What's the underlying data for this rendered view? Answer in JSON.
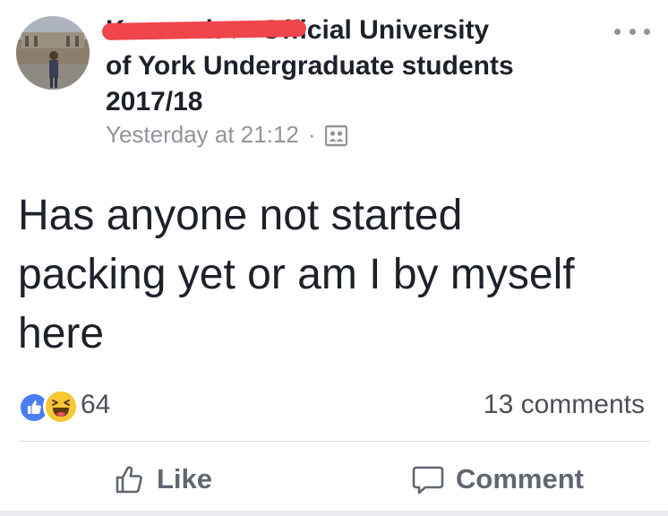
{
  "post": {
    "author_redacted": "K———h",
    "arrow": "▶",
    "group_line_1": "Official University",
    "group_line_2": "of York Undergraduate students",
    "group_line_3": "2017/18",
    "timestamp": "Yesterday at 21:12",
    "separator": "·",
    "privacy_icon": "group-icon",
    "text_lines": [
      "Has anyone not started",
      "packing yet or am I by myself",
      "here"
    ]
  },
  "stats": {
    "reaction_icons": [
      "like-icon",
      "haha-icon"
    ],
    "reaction_count": "64",
    "comments": "13 comments"
  },
  "actions": {
    "like_label": "Like",
    "comment_label": "Comment"
  },
  "colors": {
    "like_blue": "#4a7ef5",
    "haha_yellow": "#f7c736",
    "redaction_red": "#f0454a",
    "meta_gray": "#90949c"
  }
}
